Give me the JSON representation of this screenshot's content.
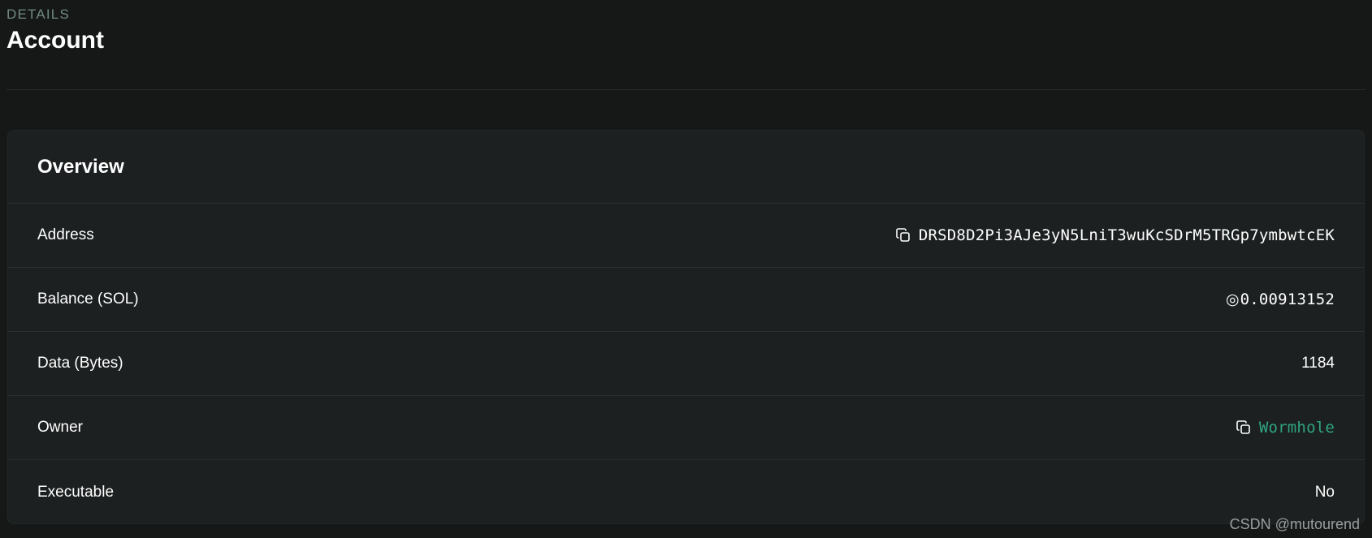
{
  "header": {
    "pretitle": "DETAILS",
    "title": "Account"
  },
  "overview": {
    "title": "Overview",
    "rows": [
      {
        "label": "Address",
        "value": "DRSD8D2Pi3AJe3yN5LniT3wuKcSDrM5TRGp7ymbwtcEK",
        "icon": "copy-icon"
      },
      {
        "label": "Balance (SOL)",
        "value": "0.00913152",
        "symbol": "◎"
      },
      {
        "label": "Data (Bytes)",
        "value": "1184"
      },
      {
        "label": "Owner",
        "value": "Wormhole",
        "icon": "copy-icon",
        "link_color": "#2fa582"
      },
      {
        "label": "Executable",
        "value": "No"
      }
    ]
  },
  "watermark": "CSDN @mutourend",
  "colors": {
    "background": "#161818",
    "card": "#1c2020",
    "accent": "#2fa582",
    "pretitle": "#6f8a80"
  }
}
